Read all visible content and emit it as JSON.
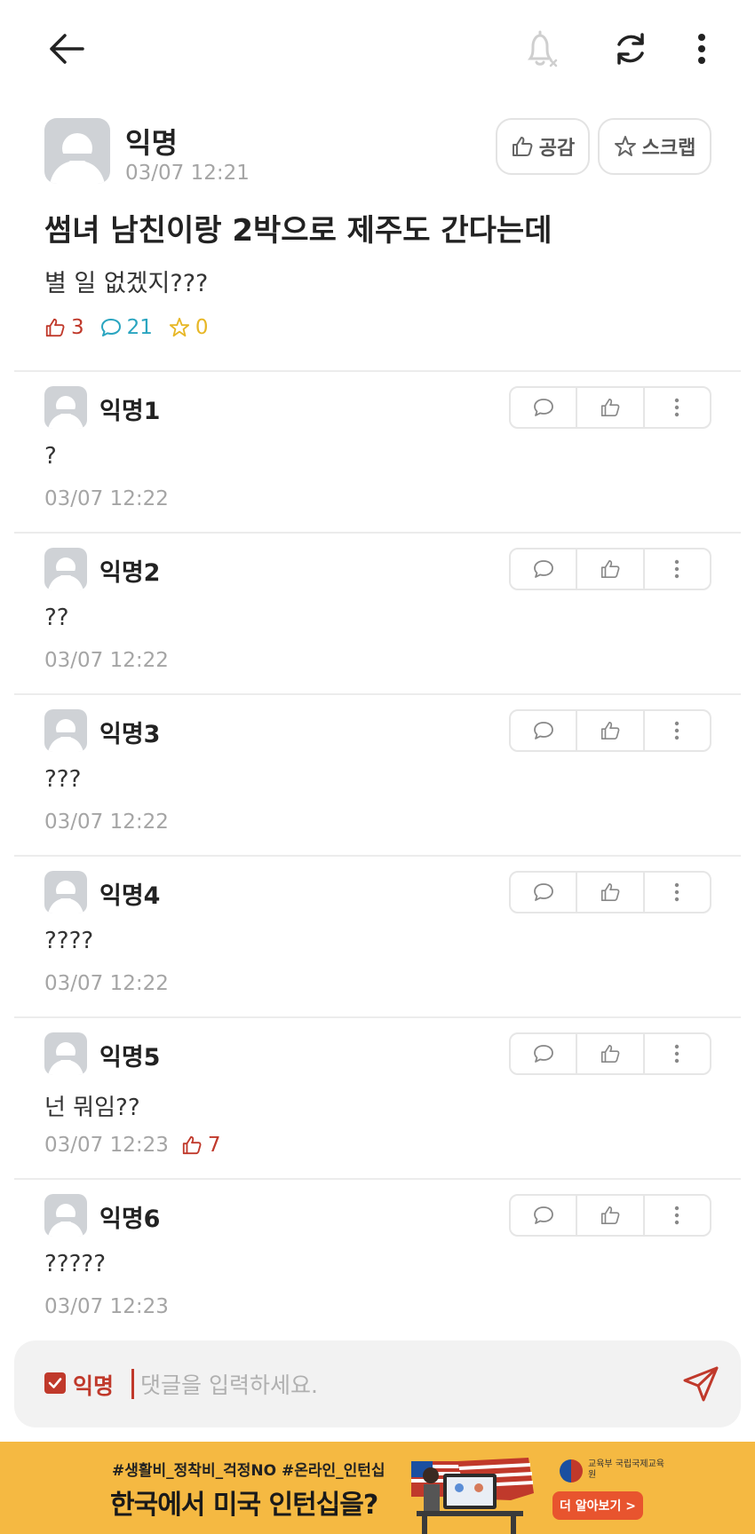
{
  "post": {
    "author": "익명",
    "time": "03/07 12:21",
    "like_button": "공감",
    "scrap_button": "스크랩",
    "title": "썸녀 남친이랑 2박으로 제주도 간다는데",
    "body": "별 일 없겠지???",
    "stats": {
      "likes": "3",
      "comments": "21",
      "scraps": "0"
    }
  },
  "comments": [
    {
      "author": "익명1",
      "body": "?",
      "time": "03/07 12:22",
      "votes": ""
    },
    {
      "author": "익명2",
      "body": "??",
      "time": "03/07 12:22",
      "votes": ""
    },
    {
      "author": "익명3",
      "body": "???",
      "time": "03/07 12:22",
      "votes": ""
    },
    {
      "author": "익명4",
      "body": "????",
      "time": "03/07 12:22",
      "votes": ""
    },
    {
      "author": "익명5",
      "body": "넌 뭐임??",
      "time": "03/07 12:23",
      "votes": "7"
    },
    {
      "author": "익명6",
      "body": "?????",
      "time": "03/07 12:23",
      "votes": ""
    }
  ],
  "input": {
    "anonymous_label": "익명",
    "anonymous_checked": true,
    "placeholder": "댓글을 입력하세요."
  },
  "ad": {
    "tags": "#생활비_정착비_걱정NO #온라인_인턴십",
    "title": "한국에서 미국 인턴십을?",
    "org": "교육부 국립국제교육원",
    "cta": "더 알아보기 >"
  },
  "colors": {
    "accent": "#c0392b",
    "comment_stat": "#2aa5c0",
    "scrap_stat": "#e7b726",
    "muted": "#a5a5a5",
    "ad_background": "#f5b942"
  }
}
